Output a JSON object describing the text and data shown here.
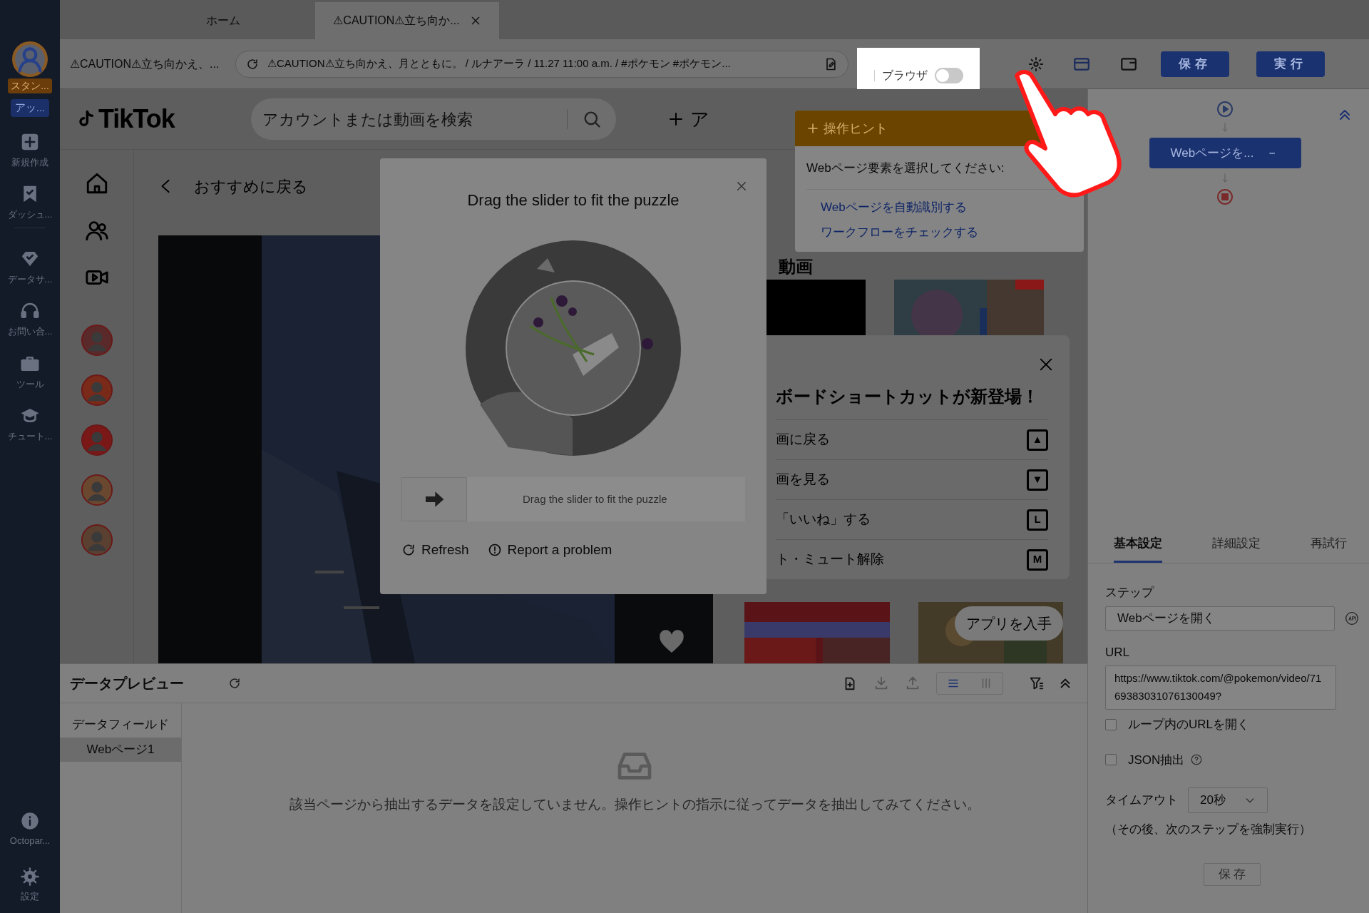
{
  "sidebar": {
    "account": {
      "badge": "スタン...",
      "plan": "アッ..."
    },
    "items": [
      {
        "kind": "plus",
        "label": "新規作成"
      },
      {
        "kind": "flag",
        "label": "ダッシュ..."
      },
      {
        "kind": "diamond",
        "label": "データサ..."
      },
      {
        "kind": "headset",
        "label": "お問い合..."
      },
      {
        "kind": "toolbox",
        "label": "ツール"
      },
      {
        "kind": "cap",
        "label": "チュート..."
      }
    ],
    "bottom_items": [
      {
        "kind": "info",
        "label": "Octopar..."
      },
      {
        "kind": "gear",
        "label": "設定"
      }
    ]
  },
  "tabs": [
    {
      "label": "ホーム",
      "selected": false
    },
    {
      "label": "⚠CAUTION⚠立ち向か...",
      "selected": true
    }
  ],
  "address_bar": {
    "page_title": "⚠CAUTION⚠立ち向かえ、...",
    "url": "⚠CAUTION⚠立ち向かえ、月とともに。 / ルナアーラ / 11.27 11:00 a.m. / #ポケモン #ポケモン...",
    "browser_toggle": {
      "label": "ブラウザ",
      "on": false
    }
  },
  "toolbar_buttons": [
    {
      "label": "保存"
    },
    {
      "label": "実行"
    }
  ],
  "browser_page": {
    "logo": "TikTok",
    "search_placeholder": "アカウントまたは動画を検索",
    "upload_label": "ア",
    "back_label": "おすすめに戻る",
    "nav_items": [
      {
        "kind": "home"
      },
      {
        "kind": "people"
      },
      {
        "kind": "video"
      }
    ],
    "related_heading": "動画",
    "shortcuts": {
      "title": "ボードショートカットが新登場！",
      "items": [
        {
          "label": "画に戻る",
          "key": "▲"
        },
        {
          "label": "画を見る",
          "key": "▼"
        },
        {
          "label": "「いいね」する",
          "key": "L"
        },
        {
          "label": "ト・ミュート解除",
          "key": "M"
        }
      ]
    },
    "get_app": "アプリを入手"
  },
  "captcha": {
    "title": "Drag the slider to fit the puzzle",
    "slider_hint": "Drag the slider to fit the puzzle",
    "slider": {
      "level": 0
    },
    "actions": [
      {
        "kind": "refresh",
        "label": "Refresh"
      },
      {
        "kind": "report",
        "label": "Report a problem"
      }
    ]
  },
  "hint_popup": {
    "title": "操作ヒント",
    "prompt": "Webページ要素を選択してください:",
    "links": [
      "Webページを自動識別する",
      "ワークフローをチェックする"
    ]
  },
  "workflow": {
    "node": "Webページを..."
  },
  "settings": {
    "tabs": [
      {
        "label": "基本設定",
        "selected": true
      },
      {
        "label": "詳細設定",
        "selected": false
      },
      {
        "label": "再試行",
        "selected": false
      }
    ],
    "step_label": "ステップ",
    "step_value": "Webページを開く",
    "url_label": "URL",
    "url_value": "https://www.tiktok.com/@pokemon/video/7169383031076130049?",
    "checkboxes": [
      {
        "label": "ループ内のURLを開く",
        "checked": false,
        "help": false
      },
      {
        "label": "JSON抽出",
        "checked": false,
        "help": true
      }
    ],
    "timeout_label": "タイムアウト",
    "timeout_value": "20秒",
    "note": "（その後、次のステップを強制実行）",
    "save": "保 存"
  },
  "preview": {
    "title": "データプレビュー",
    "field_header": "データフィールド",
    "fields": [
      {
        "label": "Webページ1",
        "selected": true
      }
    ],
    "view_modes": [
      {
        "kind": "list",
        "selected": true
      },
      {
        "kind": "columns",
        "selected": false
      }
    ],
    "empty_message": "該当ページから抽出するデータを設定していません。操作ヒントの指示に従ってデータを抽出してみてください。"
  }
}
